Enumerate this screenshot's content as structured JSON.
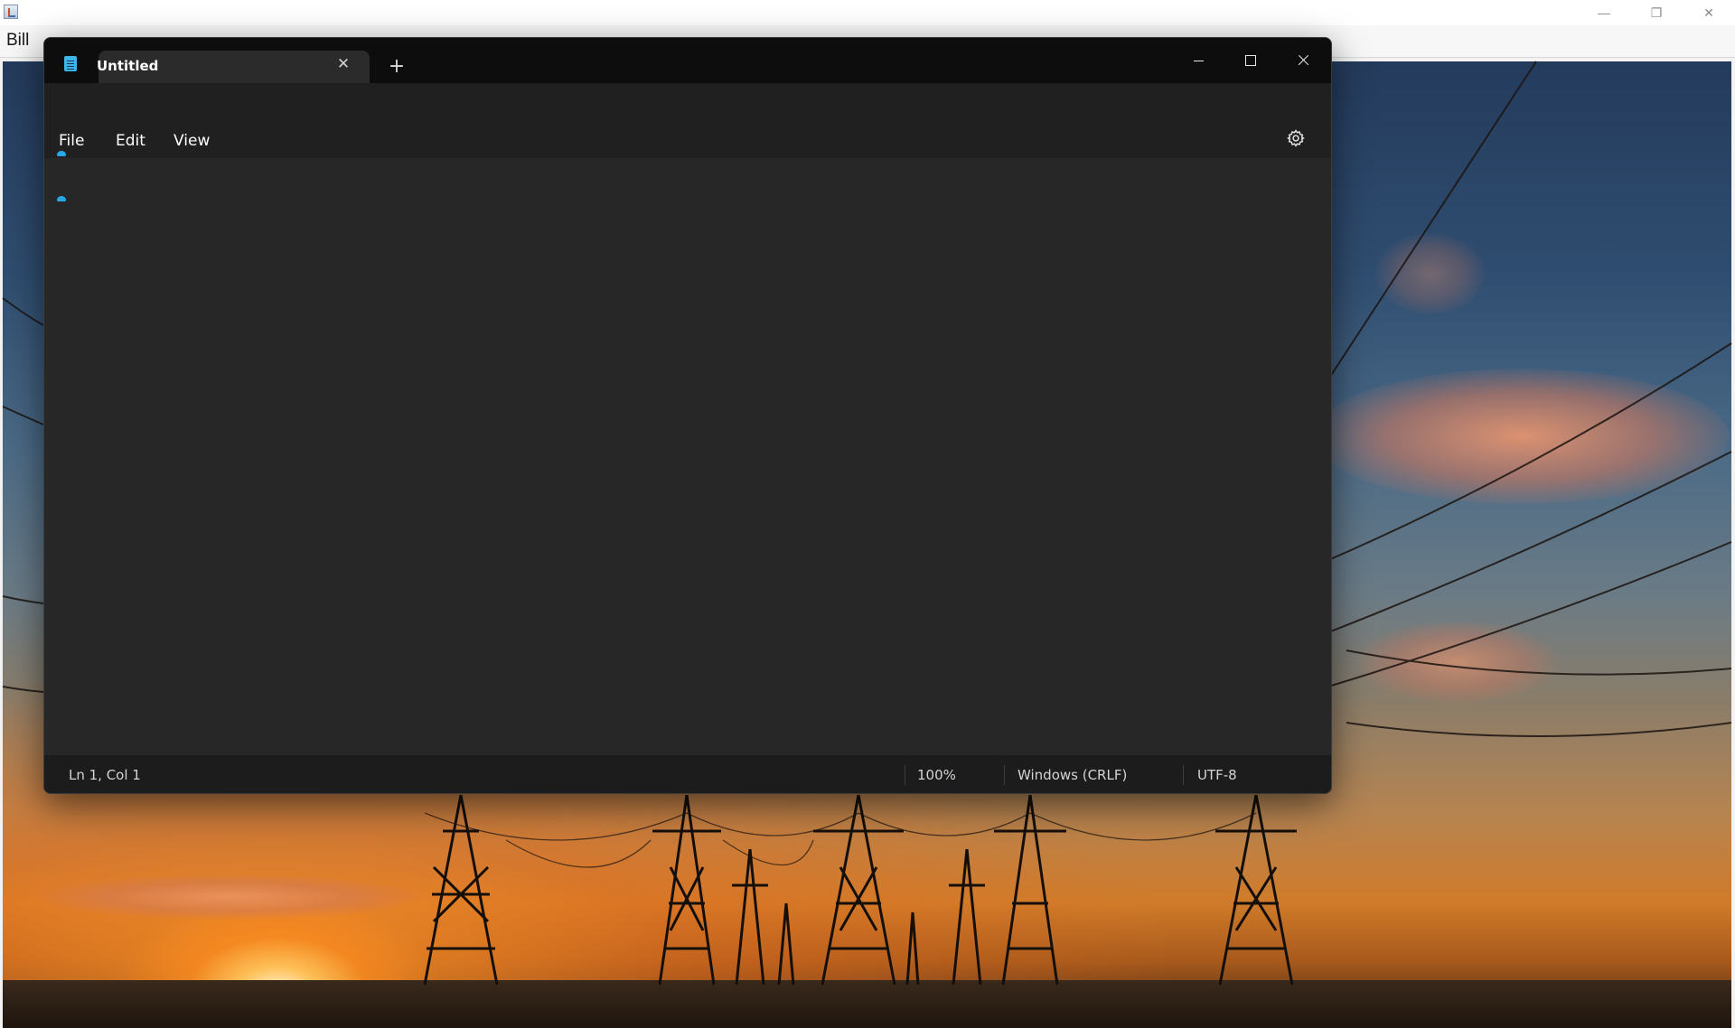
{
  "background_app": {
    "menu": {
      "visible_item": "Bill"
    },
    "window_controls": {
      "minimize_icon": "minimize-icon",
      "restore_icon": "restore-icon",
      "close_icon": "close-icon"
    }
  },
  "notepad": {
    "tab": {
      "title": "Untitled",
      "close_icon": "close-icon",
      "new_tab_label": "+"
    },
    "menu": {
      "file": "File",
      "edit": "Edit",
      "view": "View"
    },
    "status": {
      "position": "Ln 1, Col 1",
      "zoom": "100%",
      "line_endings": "Windows (CRLF)",
      "encoding": "UTF-8"
    },
    "colors": {
      "accent": "#2aa6e0",
      "titlebar": "#0d0d0d",
      "editor": "#272727"
    }
  }
}
